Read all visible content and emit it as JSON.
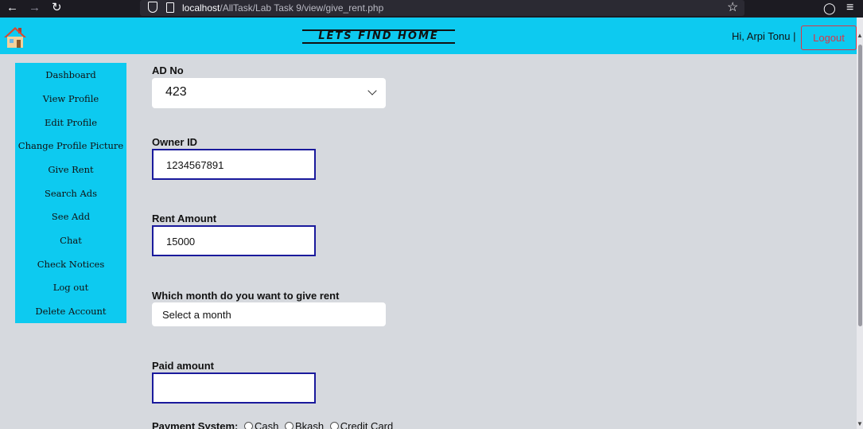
{
  "browser": {
    "url_host": "localhost",
    "url_path": "/AllTask/Lab Task 9/view/give_rent.php"
  },
  "header": {
    "title": "Lets Find Home",
    "greeting": "Hi, Arpi Tonu |",
    "logout_label": "Logout",
    "accent_color": "#0dcaf0"
  },
  "sidebar": {
    "items": [
      {
        "label": "Dashboard"
      },
      {
        "label": "View Profile"
      },
      {
        "label": "Edit Profile"
      },
      {
        "label": "Change Profile Picture"
      },
      {
        "label": "Give Rent"
      },
      {
        "label": "Search Ads"
      },
      {
        "label": "See Add"
      },
      {
        "label": "Chat"
      },
      {
        "label": "Check Notices"
      },
      {
        "label": "Log out"
      },
      {
        "label": "Delete Account"
      }
    ]
  },
  "form": {
    "ad_no_label": "AD No",
    "ad_no_value": "423",
    "owner_id_label": "Owner ID",
    "owner_id_value": "1234567891",
    "rent_amount_label": "Rent Amount",
    "rent_amount_value": "15000",
    "month_label": "Which month do you want to give rent",
    "month_value": "Select a month",
    "paid_amount_label": "Paid amount",
    "paid_amount_value": "",
    "payment_label": "Payment System:",
    "payment_options": [
      "Cash",
      "Bkash",
      "Credit Card"
    ]
  }
}
